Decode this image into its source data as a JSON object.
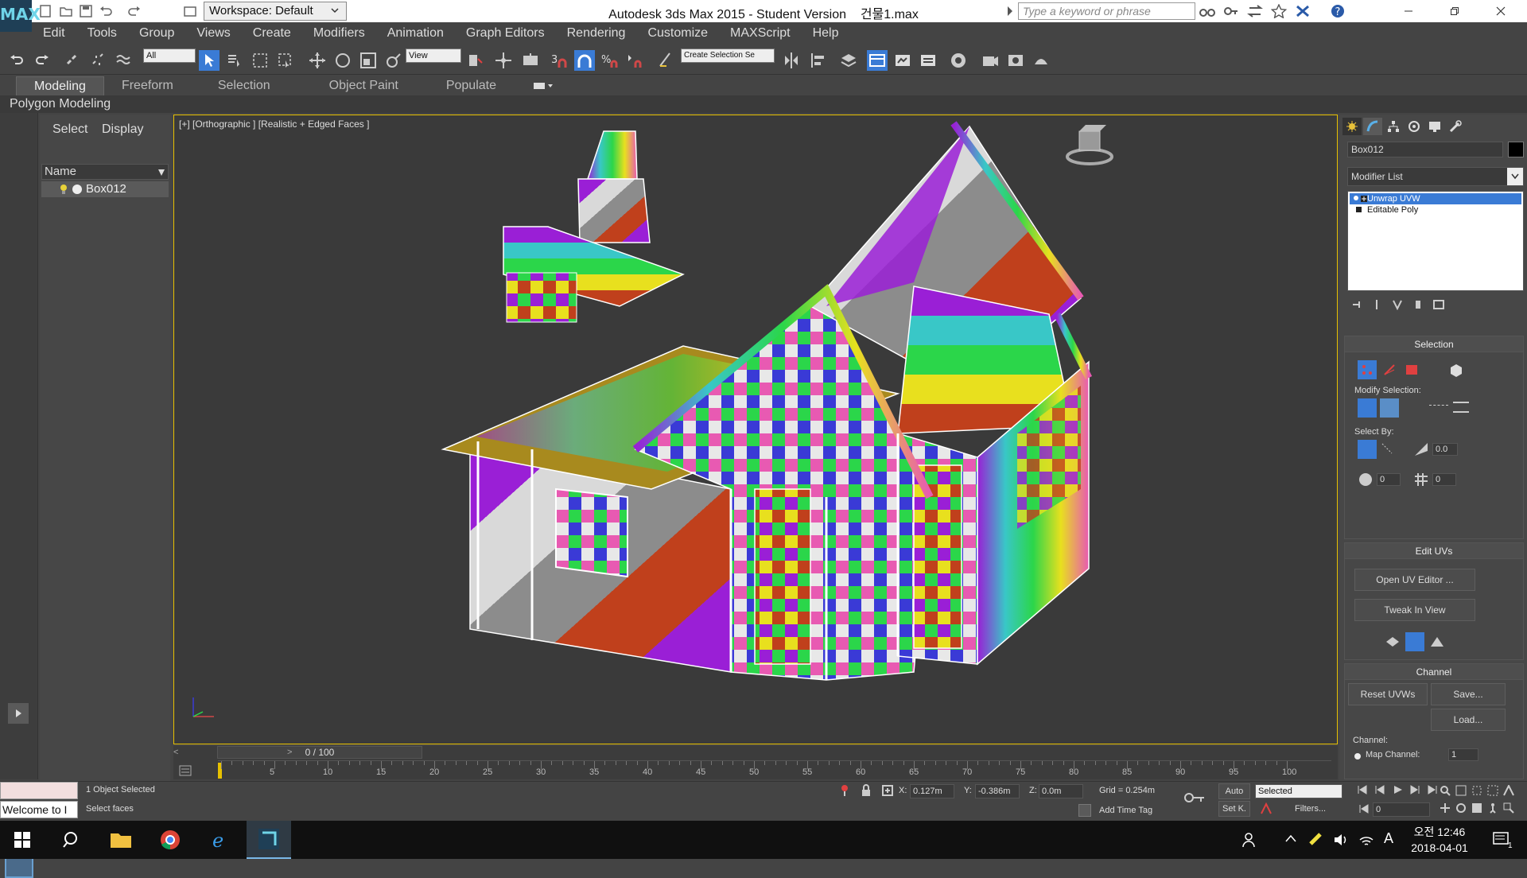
{
  "titlebar": {
    "logo": "MAX",
    "workspace": "Workspace: Default",
    "title": "Autodesk 3ds Max  2015   - Student Version",
    "filename": "건물1.max",
    "search_placeholder": "Type a keyword or phrase"
  },
  "menus": [
    "Edit",
    "Tools",
    "Group",
    "Views",
    "Create",
    "Modifiers",
    "Animation",
    "Graph Editors",
    "Rendering",
    "Customize",
    "MAXScript",
    "Help"
  ],
  "toolbar": {
    "filter_value": "All",
    "refcoord_value": "View",
    "selection_set_placeholder": "Create Selection Se"
  },
  "ribbon": {
    "tabs": [
      "Modeling",
      "Freeform",
      "Selection",
      "Object Paint",
      "Populate"
    ],
    "active_panel": "Polygon Modeling"
  },
  "explorer": {
    "tabs": [
      "Select",
      "Display"
    ],
    "column_header": "Name",
    "objects": [
      "Box012"
    ]
  },
  "viewport": {
    "label": "[+] [Orthographic ] [Realistic + Edged Faces ]",
    "object_colors": [
      "#9a1fd6",
      "#39c7c7",
      "#2bd64a",
      "#e8e01e",
      "#c0401c",
      "#8c8c8c",
      "#d9d9d9",
      "#3a3ad6",
      "#e85ab2"
    ]
  },
  "timeline": {
    "slider": "0 / 100",
    "ticks": [
      "5",
      "10",
      "15",
      "20",
      "25",
      "30",
      "35",
      "40",
      "45",
      "50",
      "55",
      "60",
      "65",
      "70",
      "75",
      "80",
      "85",
      "90",
      "95",
      "100"
    ]
  },
  "command_panel": {
    "object_name": "Box012",
    "modifier_list": "Modifier List",
    "stack": [
      "Unwrap UVW",
      "Editable Poly"
    ],
    "selection": {
      "title": "Selection",
      "modify_label": "Modify Selection:",
      "select_by_label": "Select By:",
      "angle_value": "0.0",
      "spin1": "0",
      "spin2": "0"
    },
    "edit_uvs": {
      "title": "Edit UVs",
      "open_editor": "Open UV Editor ...",
      "tweak": "Tweak In View"
    },
    "channel": {
      "title": "Channel",
      "reset": "Reset UVWs",
      "save": "Save...",
      "load": "Load...",
      "channel_label": "Channel:",
      "map_channel": "Map Channel:",
      "map_value": "1"
    }
  },
  "status": {
    "script_text": "Welcome to I",
    "objects_selected": "1 Object Selected",
    "prompt": "Select faces",
    "x_label": "X:",
    "x": "0.127m",
    "y_label": "Y:",
    "y": "-0.386m",
    "z_label": "Z:",
    "z": "0.0m",
    "grid": "Grid = 0.254m",
    "add_time_tag": "Add Time Tag",
    "auto": "Auto",
    "selected": "Selected",
    "setk": "Set K.",
    "filters": "Filters...",
    "frame": "0"
  },
  "taskbar": {
    "ime": "A",
    "time": "오전 12:46",
    "date": "2018-04-01",
    "notif_count": "1"
  }
}
